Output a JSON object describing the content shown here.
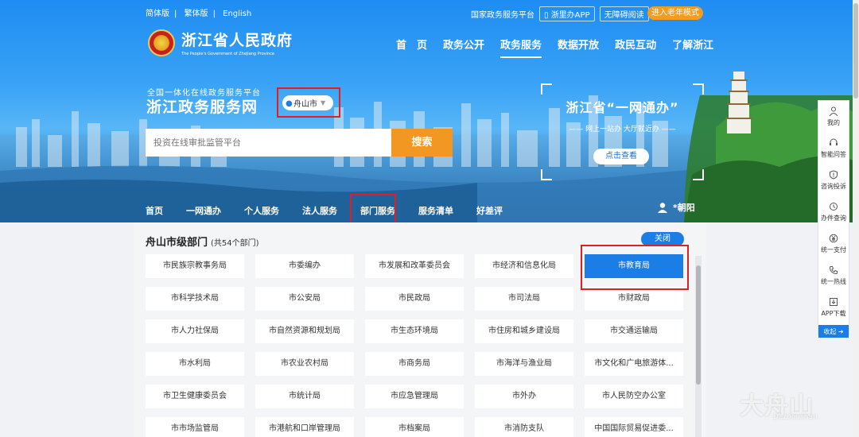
{
  "topbar": {
    "lang_simplified": "简体版",
    "lang_traditional": "繁体版",
    "lang_english": "English",
    "national_platform": "国家政务服务平台",
    "app_label": "浙里办APP",
    "accessibility": "无障碍阅读",
    "elder_mode": "进入老年模式"
  },
  "logo": {
    "name": "浙江省人民政府",
    "english": "The People's Government of Zhejiang Province"
  },
  "main_nav": [
    {
      "label": "首　页"
    },
    {
      "label": "政务公开"
    },
    {
      "label": "政务服务"
    },
    {
      "label": "数据开放"
    },
    {
      "label": "政民互动"
    },
    {
      "label": "了解浙江"
    }
  ],
  "service": {
    "subtitle": "全国一体化在线政务服务平台",
    "title": "浙江政务服务网",
    "city": "舟山市"
  },
  "search": {
    "placeholder": "投资在线审批监管平台",
    "button": "搜索"
  },
  "banner": {
    "title": "浙江省“一网通办”",
    "subtitle": "网上一站办 大厅就近办",
    "button": "点击查看"
  },
  "sub_nav": [
    {
      "label": "首页"
    },
    {
      "label": "一网通办"
    },
    {
      "label": "个人服务"
    },
    {
      "label": "法人服务"
    },
    {
      "label": "部门服务"
    },
    {
      "label": "服务清单"
    },
    {
      "label": "好差评"
    }
  ],
  "user": {
    "name": "*朝阳"
  },
  "departments": {
    "title": "舟山市级部门",
    "count": "(共54个部门)",
    "close": "关闭",
    "items": [
      "市民族宗教事务局",
      "市委编办",
      "市发展和改革委员会",
      "市经济和信息化局",
      "市教育局",
      "市科学技术局",
      "市公安局",
      "市民政局",
      "市司法局",
      "市财政局",
      "市人力社保局",
      "市自然资源和规划局",
      "市生态环境局",
      "市住房和城乡建设局",
      "市交通运输局",
      "市水利局",
      "市农业农村局",
      "市商务局",
      "市海洋与渔业局",
      "市文化和广电旅游体...",
      "市卫生健康委员会",
      "市统计局",
      "市应急管理局",
      "市外办",
      "市人民防空办公室",
      "市市场监管局",
      "市港航和口岸管理局",
      "市档案局",
      "市消防支队",
      "中国国际贸易促进委..."
    ]
  },
  "tools": [
    {
      "label": "我的",
      "icon": "person-icon"
    },
    {
      "label": "智能问答",
      "icon": "headset-icon"
    },
    {
      "label": "咨询投诉",
      "icon": "shield-icon"
    },
    {
      "label": "办件查询",
      "icon": "history-icon"
    },
    {
      "label": "统一支付",
      "icon": "yuan-icon"
    },
    {
      "label": "统一热线",
      "icon": "phone-icon"
    },
    {
      "label": "APP下载",
      "icon": "download-icon"
    }
  ],
  "tools_collapse": "收起",
  "watermark": {
    "text": "大舟山",
    "sub": "Dazhoushan"
  }
}
